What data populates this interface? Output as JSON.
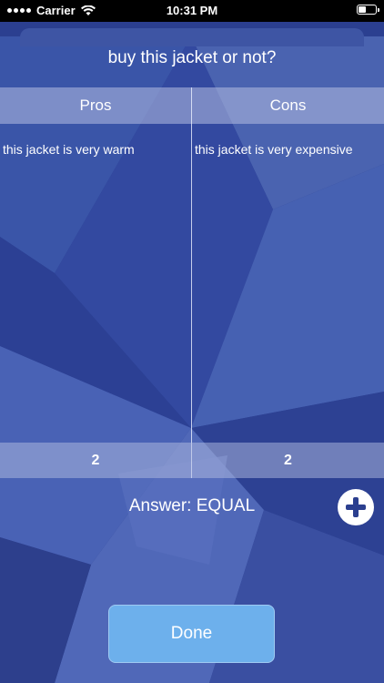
{
  "status_bar": {
    "carrier": "Carrier",
    "time": "10:31 PM"
  },
  "title": "buy this jacket or not?",
  "columns": {
    "pros": {
      "header": "Pros",
      "items": [
        "this jacket is very warm"
      ],
      "count": "2"
    },
    "cons": {
      "header": "Cons",
      "items": [
        "this jacket is very expensive"
      ],
      "count": "2"
    }
  },
  "answer": "Answer: EQUAL",
  "done_label": "Done",
  "icons": {
    "add": "plus-circle-icon",
    "wifi": "wifi-icon",
    "battery": "battery-icon"
  },
  "colors": {
    "background": "#2a3f8f",
    "done_button": "#6db0ec"
  }
}
